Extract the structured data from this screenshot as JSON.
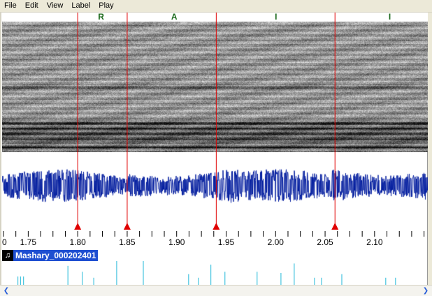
{
  "menu": [
    {
      "name": "file",
      "label": "File"
    },
    {
      "name": "edit",
      "label": "Edit"
    },
    {
      "name": "view",
      "label": "View"
    },
    {
      "name": "label",
      "label": "Label"
    },
    {
      "name": "play",
      "label": "Play"
    }
  ],
  "time_axis": {
    "range_seconds": [
      1.7236,
      2.1538
    ],
    "major_ticks": [
      {
        "value": 1.75,
        "label": "1.75"
      },
      {
        "value": 1.8,
        "label": "1.80"
      },
      {
        "value": 1.85,
        "label": "1.85"
      },
      {
        "value": 1.9,
        "label": "1.90"
      },
      {
        "value": 1.95,
        "label": "1.95"
      },
      {
        "value": 2.0,
        "label": "2.00"
      },
      {
        "value": 2.05,
        "label": "2.05"
      },
      {
        "value": 2.1,
        "label": "2.10"
      }
    ],
    "edge_label": "0",
    "minor_tick_step": 0.0125
  },
  "phoneme_labels": [
    {
      "text": "R",
      "time": 1.8236
    },
    {
      "text": "A",
      "time": 1.8975
    },
    {
      "text": "I",
      "time": 2.0004
    },
    {
      "text": "I",
      "time": 2.1153
    }
  ],
  "boundary_markers": [
    1.8,
    1.85,
    1.94,
    2.06
  ],
  "track": {
    "name": "Mashary_000202401",
    "icon": "speaker-icon"
  },
  "event_lines": [
    {
      "time": 1.7396,
      "level": 0.35
    },
    {
      "time": 1.7422,
      "level": 0.35
    },
    {
      "time": 1.7453,
      "level": 0.35
    },
    {
      "time": 1.7901,
      "level": 0.8
    },
    {
      "time": 1.8046,
      "level": 0.55
    },
    {
      "time": 1.8162,
      "level": 0.3
    },
    {
      "time": 1.8394,
      "level": 1.0
    },
    {
      "time": 1.8663,
      "level": 1.0
    },
    {
      "time": 1.9121,
      "level": 0.45
    },
    {
      "time": 1.922,
      "level": 0.3
    },
    {
      "time": 1.9346,
      "level": 0.85
    },
    {
      "time": 1.9488,
      "level": 0.55
    },
    {
      "time": 1.9813,
      "level": 0.55
    },
    {
      "time": 2.0054,
      "level": 0.5
    },
    {
      "time": 2.0188,
      "level": 0.9
    },
    {
      "time": 2.0393,
      "level": 0.3
    },
    {
      "time": 2.0464,
      "level": 0.3
    },
    {
      "time": 2.0669,
      "level": 0.45
    },
    {
      "time": 2.1113,
      "level": 0.3
    },
    {
      "time": 2.1212,
      "level": 0.3
    }
  ],
  "colors": {
    "waveform": "#001c9e",
    "marker": "#e00000",
    "event_line": "#20b8d8",
    "label_text": "#1d6b1d",
    "track_header": "#1f4fd1"
  }
}
